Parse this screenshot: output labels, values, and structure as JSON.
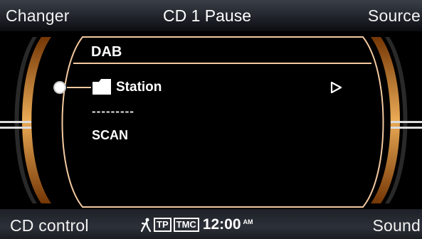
{
  "topbar": {
    "left_softkey": "Changer",
    "status": "CD 1 Pause",
    "right_softkey": "Source"
  },
  "menu": {
    "header": "DAB",
    "items": [
      {
        "label": "Station",
        "icon": "folder-icon",
        "has_submenu": true,
        "selected": true
      },
      {
        "label": "---------"
      },
      {
        "label": "SCAN"
      }
    ]
  },
  "bottombar": {
    "left_softkey": "CD control",
    "tp": "TP",
    "tmc": "TMC",
    "time": "12:00",
    "ampm": "AM",
    "right_softkey": "Sound"
  },
  "colors": {
    "accent_orange": "#f0a24a",
    "frame_line": "#f3c9a0",
    "background": "#000000"
  }
}
